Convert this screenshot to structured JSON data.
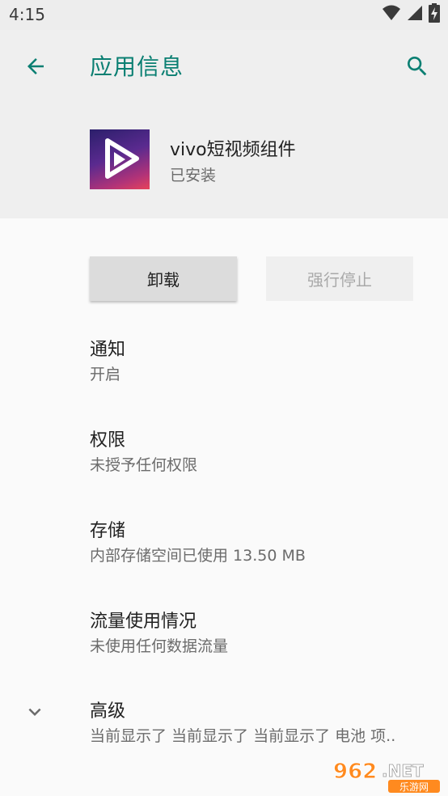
{
  "status_bar": {
    "time": "4:15",
    "icons": [
      "wifi-icon",
      "signal-icon",
      "battery-charging-icon"
    ]
  },
  "header": {
    "title": "应用信息",
    "back_icon": "arrow-back-icon",
    "search_icon": "search-icon"
  },
  "app": {
    "name": "vivo短视频组件",
    "status": "已安装"
  },
  "actions": {
    "uninstall_label": "卸载",
    "force_stop_label": "强行停止"
  },
  "settings": [
    {
      "title": "通知",
      "subtitle": "开启"
    },
    {
      "title": "权限",
      "subtitle": "未授予任何权限"
    },
    {
      "title": "存储",
      "subtitle": "内部存储空间已使用 13.50 MB"
    },
    {
      "title": "流量使用情况",
      "subtitle": "未使用任何数据流量"
    },
    {
      "title": "高级",
      "subtitle": "当前显示了 当前显示了 当前显示了 电池 项.."
    }
  ],
  "watermark": {
    "brand": "962",
    "suffix": ".NET",
    "subtitle": "乐游网"
  },
  "colors": {
    "accent": "#0a7f72",
    "header_bg": "#efefef",
    "page_bg": "#fafafa"
  }
}
